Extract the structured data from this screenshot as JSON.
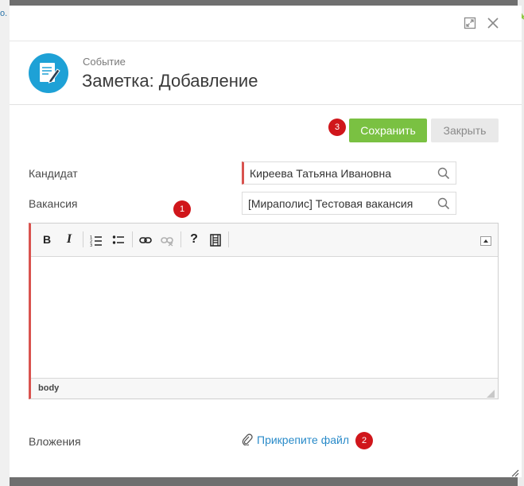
{
  "backdrop": {
    "edge_text": "о."
  },
  "modal": {
    "header": {
      "subtitle": "Событие",
      "title": "Заметка: Добавление",
      "badge_icon": "note-edit-icon",
      "badge_color": "#1ea1d6"
    },
    "actions": {
      "save_label": "Сохранить",
      "close_label": "Закрыть",
      "save_color": "#7ac142"
    },
    "form": {
      "candidate_label": "Кандидат",
      "candidate_value": "Киреева Татьяна Ивановна",
      "vacancy_label": "Вакансия",
      "vacancy_value": "[Мираполис] Тестовая вакансия",
      "attachments_label": "Вложения",
      "attach_link": "Прикрепите файл"
    },
    "editor": {
      "toolbar": [
        "bold",
        "italic",
        "numbered-list",
        "bulleted-list",
        "link",
        "unlink",
        "help",
        "media"
      ],
      "status_path": "body"
    },
    "markers": [
      "1",
      "2",
      "3"
    ],
    "marker_color": "#d0161b"
  }
}
